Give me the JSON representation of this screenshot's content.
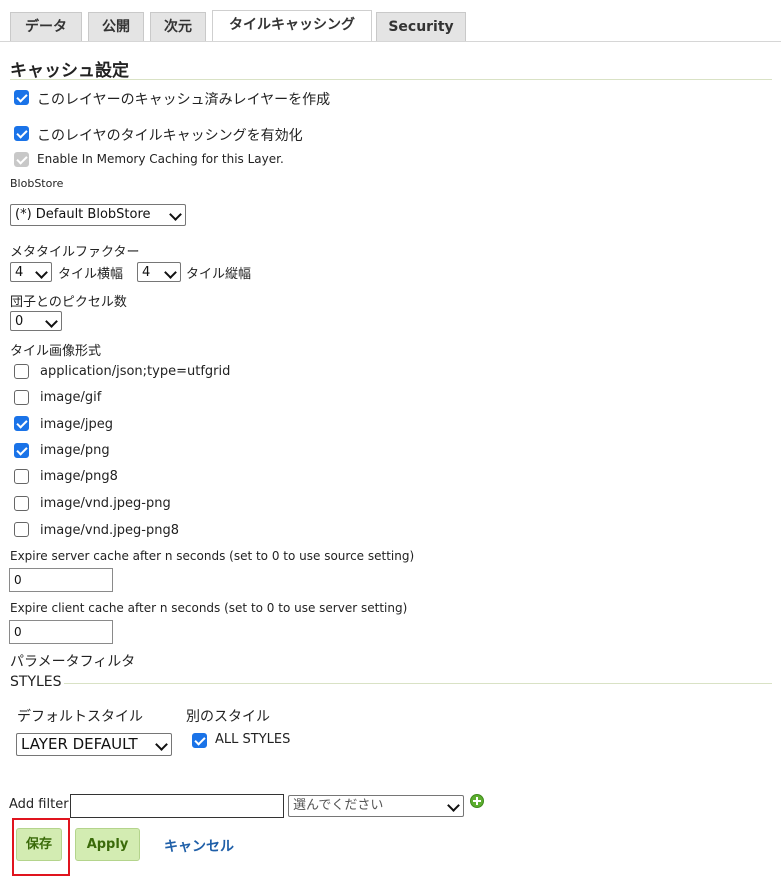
{
  "tabs": [
    "データ",
    "公開",
    "次元",
    "タイルキャッシング",
    "Security"
  ],
  "active_tab": "タイルキャッシング",
  "cache_settings": {
    "title": "キャッシュ設定",
    "create_cached_layer": {
      "label": "このレイヤーのキャッシュ済みレイヤーを作成",
      "checked": true
    },
    "enable_tile_caching": {
      "label": "このレイヤのタイルキャッシングを有効化",
      "checked": true
    },
    "enable_in_memory": {
      "label": "Enable In Memory Caching for this Layer.",
      "checked": true,
      "disabled": true
    },
    "blobstore_label": "BlobStore",
    "blobstore_value": "(*) Default BlobStore",
    "metatile_label": "メタタイルファクター",
    "metatile_width_value": "4",
    "metatile_width_label": "タイル横幅",
    "metatile_height_value": "4",
    "metatile_height_label": "タイル縦幅",
    "gutter_label": "団子とのピクセル数",
    "gutter_value": "0",
    "formats_label": "タイル画像形式",
    "formats": [
      {
        "label": "application/json;type=utfgrid",
        "checked": false
      },
      {
        "label": "image/gif",
        "checked": false
      },
      {
        "label": "image/jpeg",
        "checked": true
      },
      {
        "label": "image/png",
        "checked": true
      },
      {
        "label": "image/png8",
        "checked": false
      },
      {
        "label": "image/vnd.jpeg-png",
        "checked": false
      },
      {
        "label": "image/vnd.jpeg-png8",
        "checked": false
      }
    ],
    "server_expire_label": "Expire server cache after n seconds (set to 0 to use source setting)",
    "server_expire_value": "0",
    "client_expire_label": "Expire client cache after n seconds (set to 0 to use server setting)",
    "client_expire_value": "0",
    "param_filter_label": "パラメータフィルタ"
  },
  "styles": {
    "title": "STYLES",
    "default_style_label": "デフォルトスタイル",
    "default_style_value": "LAYER DEFAULT",
    "alt_style_label": "別のスタイル",
    "all_styles_label": "ALL STYLES",
    "all_styles_checked": true
  },
  "add_filter": {
    "label": "Add filter",
    "input_value": "",
    "select_placeholder": "選んでください"
  },
  "actions": {
    "save": "保存",
    "apply": "Apply",
    "cancel": "キャンセル"
  },
  "colors": {
    "accent": "#1a73e8",
    "button_bg": "#d3ecb2",
    "highlight": "#e0141e"
  }
}
